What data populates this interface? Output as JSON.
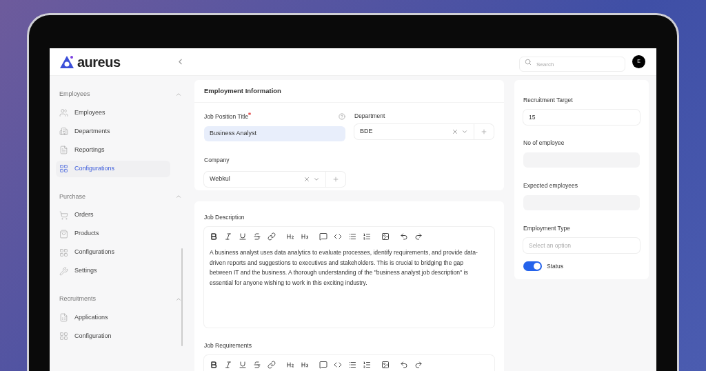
{
  "header": {
    "logo": "aureus",
    "search": {
      "placeholder": "Search"
    },
    "avatar": "E"
  },
  "sidebar": {
    "sections": [
      {
        "title": "Employees",
        "expanded": true,
        "items": [
          {
            "label": "Employees",
            "selected": false
          },
          {
            "label": "Departments",
            "selected": false
          },
          {
            "label": "Reportings",
            "selected": false
          },
          {
            "label": "Configurations",
            "selected": true
          }
        ]
      },
      {
        "title": "Purchase",
        "expanded": true,
        "items": [
          {
            "label": "Orders",
            "selected": false
          },
          {
            "label": "Products",
            "selected": false
          },
          {
            "label": "Configurations",
            "selected": false
          },
          {
            "label": "Settings",
            "selected": false
          }
        ]
      },
      {
        "title": "Recruitments",
        "expanded": true,
        "items": [
          {
            "label": "Applications",
            "selected": false
          },
          {
            "label": "Configuration",
            "selected": false
          }
        ]
      }
    ]
  },
  "employment_information": {
    "title": "Employment Information",
    "job_position_title": {
      "label": "Job Position Title",
      "required": true,
      "value": "Business Analyst",
      "focused": true
    },
    "department": {
      "label": "Department",
      "value": "BDE"
    },
    "company": {
      "label": "Company",
      "value": "Webkul"
    }
  },
  "job_description": {
    "label": "Job Description",
    "text": "A business analyst uses data analytics to evaluate processes, identify requirements, and provide data-driven reports and suggestions to executives and stakeholders. This is crucial to bridging the gap between IT and the business. A thorough understanding of the \"business analyst job description\" is essential for anyone wishing to work in this exciting industry."
  },
  "job_requirements": {
    "label": "Job Requirements"
  },
  "side_panel": {
    "fields": [
      {
        "label": "Recruitment Target",
        "value": "15",
        "disabled": false
      },
      {
        "label": "No of employee",
        "disabled": true
      },
      {
        "label": "Expected employees",
        "disabled": true
      },
      {
        "label": "Employment Type",
        "placeholder": "Select an option",
        "disabled": false
      }
    ],
    "status": {
      "label": "Status",
      "on": true
    }
  }
}
